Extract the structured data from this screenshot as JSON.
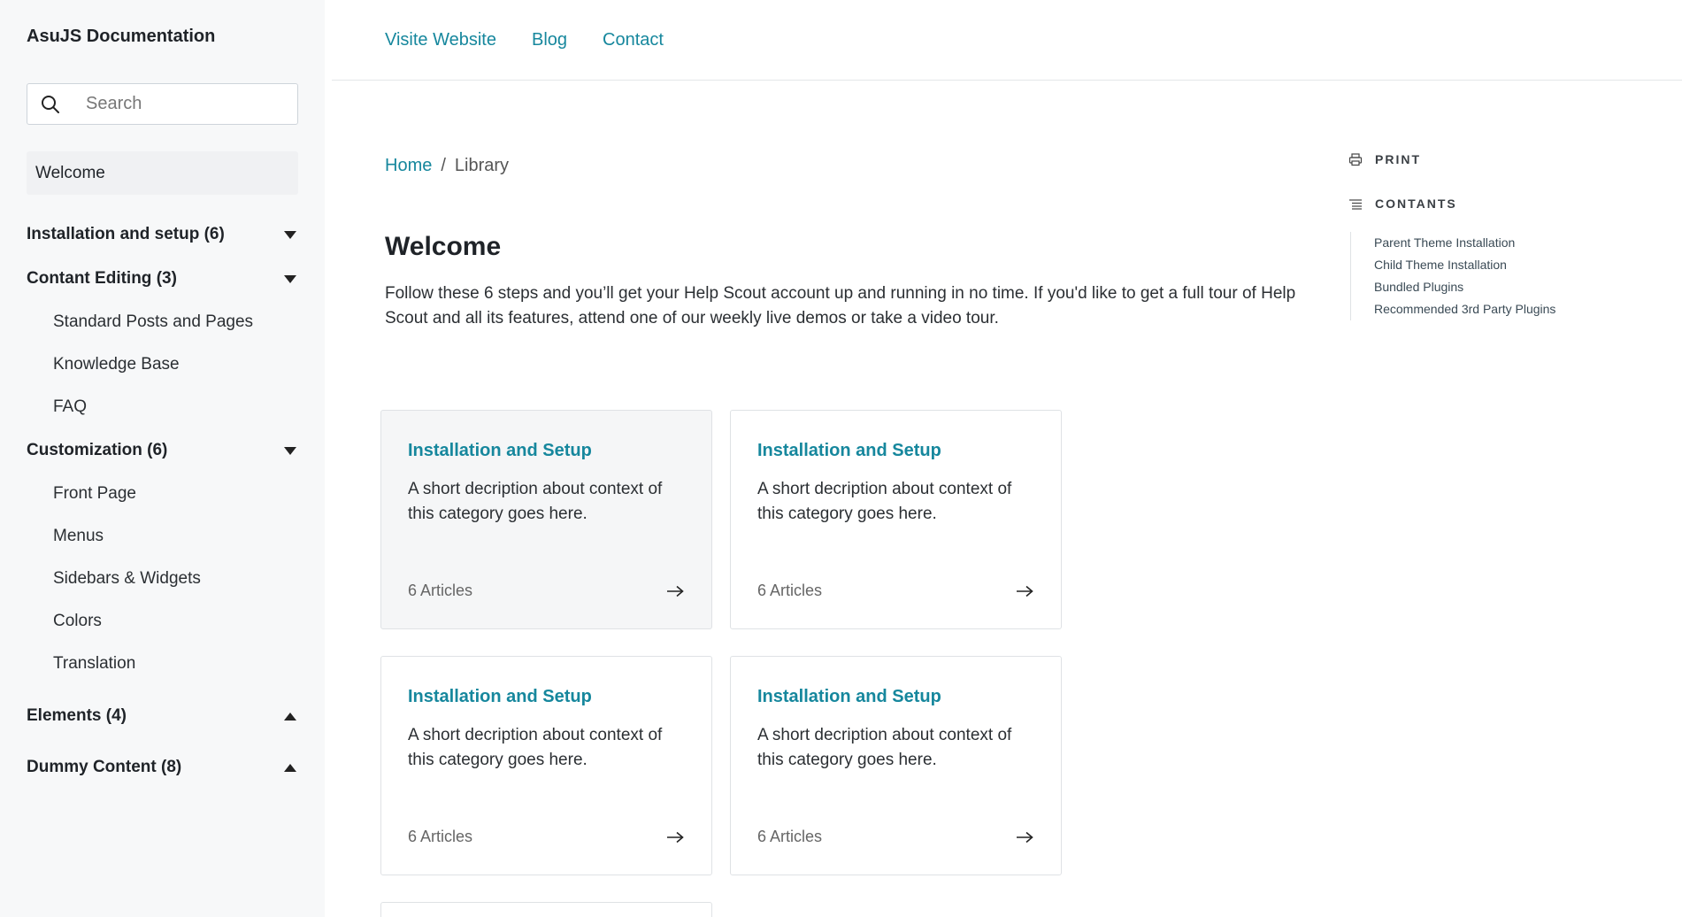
{
  "sidebar": {
    "brand": "AsuJS Documentation",
    "search_placeholder": "Search",
    "welcome": "Welcome",
    "sections": [
      {
        "label": "Installation and setup (6)",
        "expanded": false,
        "items": []
      },
      {
        "label": "Contant Editing (3)",
        "expanded": true,
        "items": [
          "Standard Posts and Pages",
          "Knowledge Base",
          "FAQ"
        ]
      },
      {
        "label": "Customization (6)",
        "expanded": true,
        "items": [
          "Front Page",
          "Menus",
          "Sidebars & Widgets",
          "Colors",
          "Translation"
        ]
      },
      {
        "label": "Elements (4)",
        "expanded": false,
        "items": []
      },
      {
        "label": "Dummy Content (8)",
        "expanded": false,
        "items": []
      }
    ]
  },
  "topnav": {
    "links": [
      "Visite Website",
      "Blog",
      "Contact"
    ]
  },
  "breadcrumb": {
    "home": "Home",
    "separator": "/",
    "current": "Library"
  },
  "main": {
    "title": "Welcome",
    "intro": "Follow these 6 steps and you’ll get your Help Scout account up and running in no time. If you'd like to get a full tour of Help Scout and all its features, attend one of our weekly live demos or take a video tour.",
    "cards": [
      {
        "title": "Installation and Setup",
        "desc": "A short decription about context of this category goes here.",
        "count": "6 Articles"
      },
      {
        "title": "Installation and Setup",
        "desc": "A short decription about context of this category goes here.",
        "count": "6 Articles"
      },
      {
        "title": "Installation and Setup",
        "desc": "A short decription about context of this category goes here.",
        "count": "6 Articles"
      },
      {
        "title": "Installation and Setup",
        "desc": "A short decription about context of this category goes here.",
        "count": "6 Articles"
      }
    ]
  },
  "toc": {
    "print_label": "PRINT",
    "contents_label": "CONTANTS",
    "items": [
      "Parent Theme Installation",
      "Child Theme Installation",
      "Bundled Plugins",
      "Recommended 3rd Party Plugins"
    ]
  },
  "colors": {
    "accent": "#16879d",
    "sidebar_bg": "#f7f8f9"
  }
}
